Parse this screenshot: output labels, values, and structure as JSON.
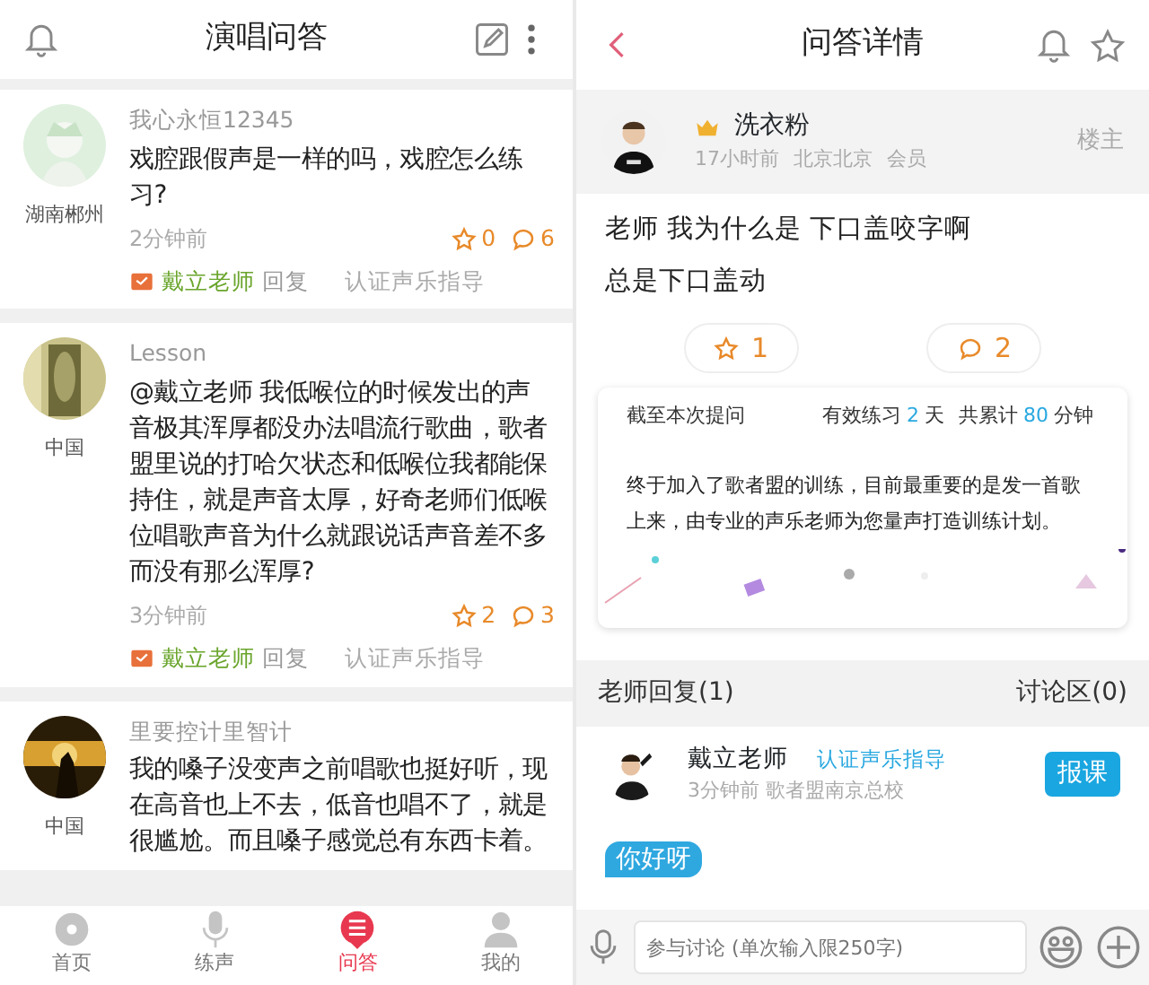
{
  "left": {
    "header": {
      "title": "演唱问答"
    },
    "posts": [
      {
        "kind": "full",
        "username": "我心永恒12345",
        "location": "湖南郴州",
        "text": "戏腔跟假声是一样的吗，戏腔怎么练习?",
        "time": "2分钟前",
        "stars": "0",
        "comments": "6",
        "teacher": "戴立老师",
        "reply_label": "回复",
        "cert": "认证声乐指导"
      },
      {
        "kind": "full",
        "username": "Lesson",
        "location": "中国",
        "text": "@戴立老师  我低喉位的时候发出的声音极其浑厚都没办法唱流行歌曲，歌者盟里说的打哈欠状态和低喉位我都能保持住，就是声音太厚，好奇老师们低喉位唱歌声音为什么就跟说话声音差不多而没有那么浑厚?",
        "time": "3分钟前",
        "stars": "2",
        "comments": "3",
        "teacher": "戴立老师",
        "reply_label": "回复",
        "cert": "认证声乐指导"
      },
      {
        "kind": "cut",
        "username": "里要控计里智计",
        "location": "中国",
        "text": "我的嗓子没变声之前唱歌也挺好听，现在高音也上不去，低音也唱不了，就是很尴尬。而且嗓子感觉总有东西卡着。"
      }
    ],
    "tabbar": [
      {
        "label": "首页",
        "kind": "disc",
        "selected": false
      },
      {
        "label": "练声",
        "kind": "mic",
        "selected": false
      },
      {
        "label": "问答",
        "kind": "qa",
        "selected": true
      },
      {
        "label": "我的",
        "kind": "person",
        "selected": false
      }
    ]
  },
  "right": {
    "header": {
      "title": "问答详情"
    },
    "op": {
      "name": "洗衣粉",
      "time": "17小时前",
      "location": "北京北京",
      "role": "会员",
      "floor": "楼主"
    },
    "question": [
      "老师 我为什么是 下口盖咬字啊",
      "总是下口盖动"
    ],
    "actions": {
      "stars": "1",
      "comments": "2"
    },
    "card": {
      "label": "截至本次提问",
      "days_pre": "有效练习",
      "days": "2",
      "days_post": "天",
      "total_pre": "共累计",
      "minutes": "80",
      "total_post": "分钟",
      "message": "终于加入了歌者盟的训练，目前最重要的是发一首歌上来，由专业的声乐老师为您量声打造训练计划。"
    },
    "section_tabs": [
      "老师回复(1)",
      "讨论区(0)"
    ],
    "reply": {
      "name": "戴立老师",
      "cert": "认证声乐指导",
      "meta": "3分钟前 歌者盟南京总校",
      "button": "报课",
      "bubble": "你好呀"
    },
    "input": {
      "placeholder": "参与讨论 (单次输入限250字)"
    }
  }
}
